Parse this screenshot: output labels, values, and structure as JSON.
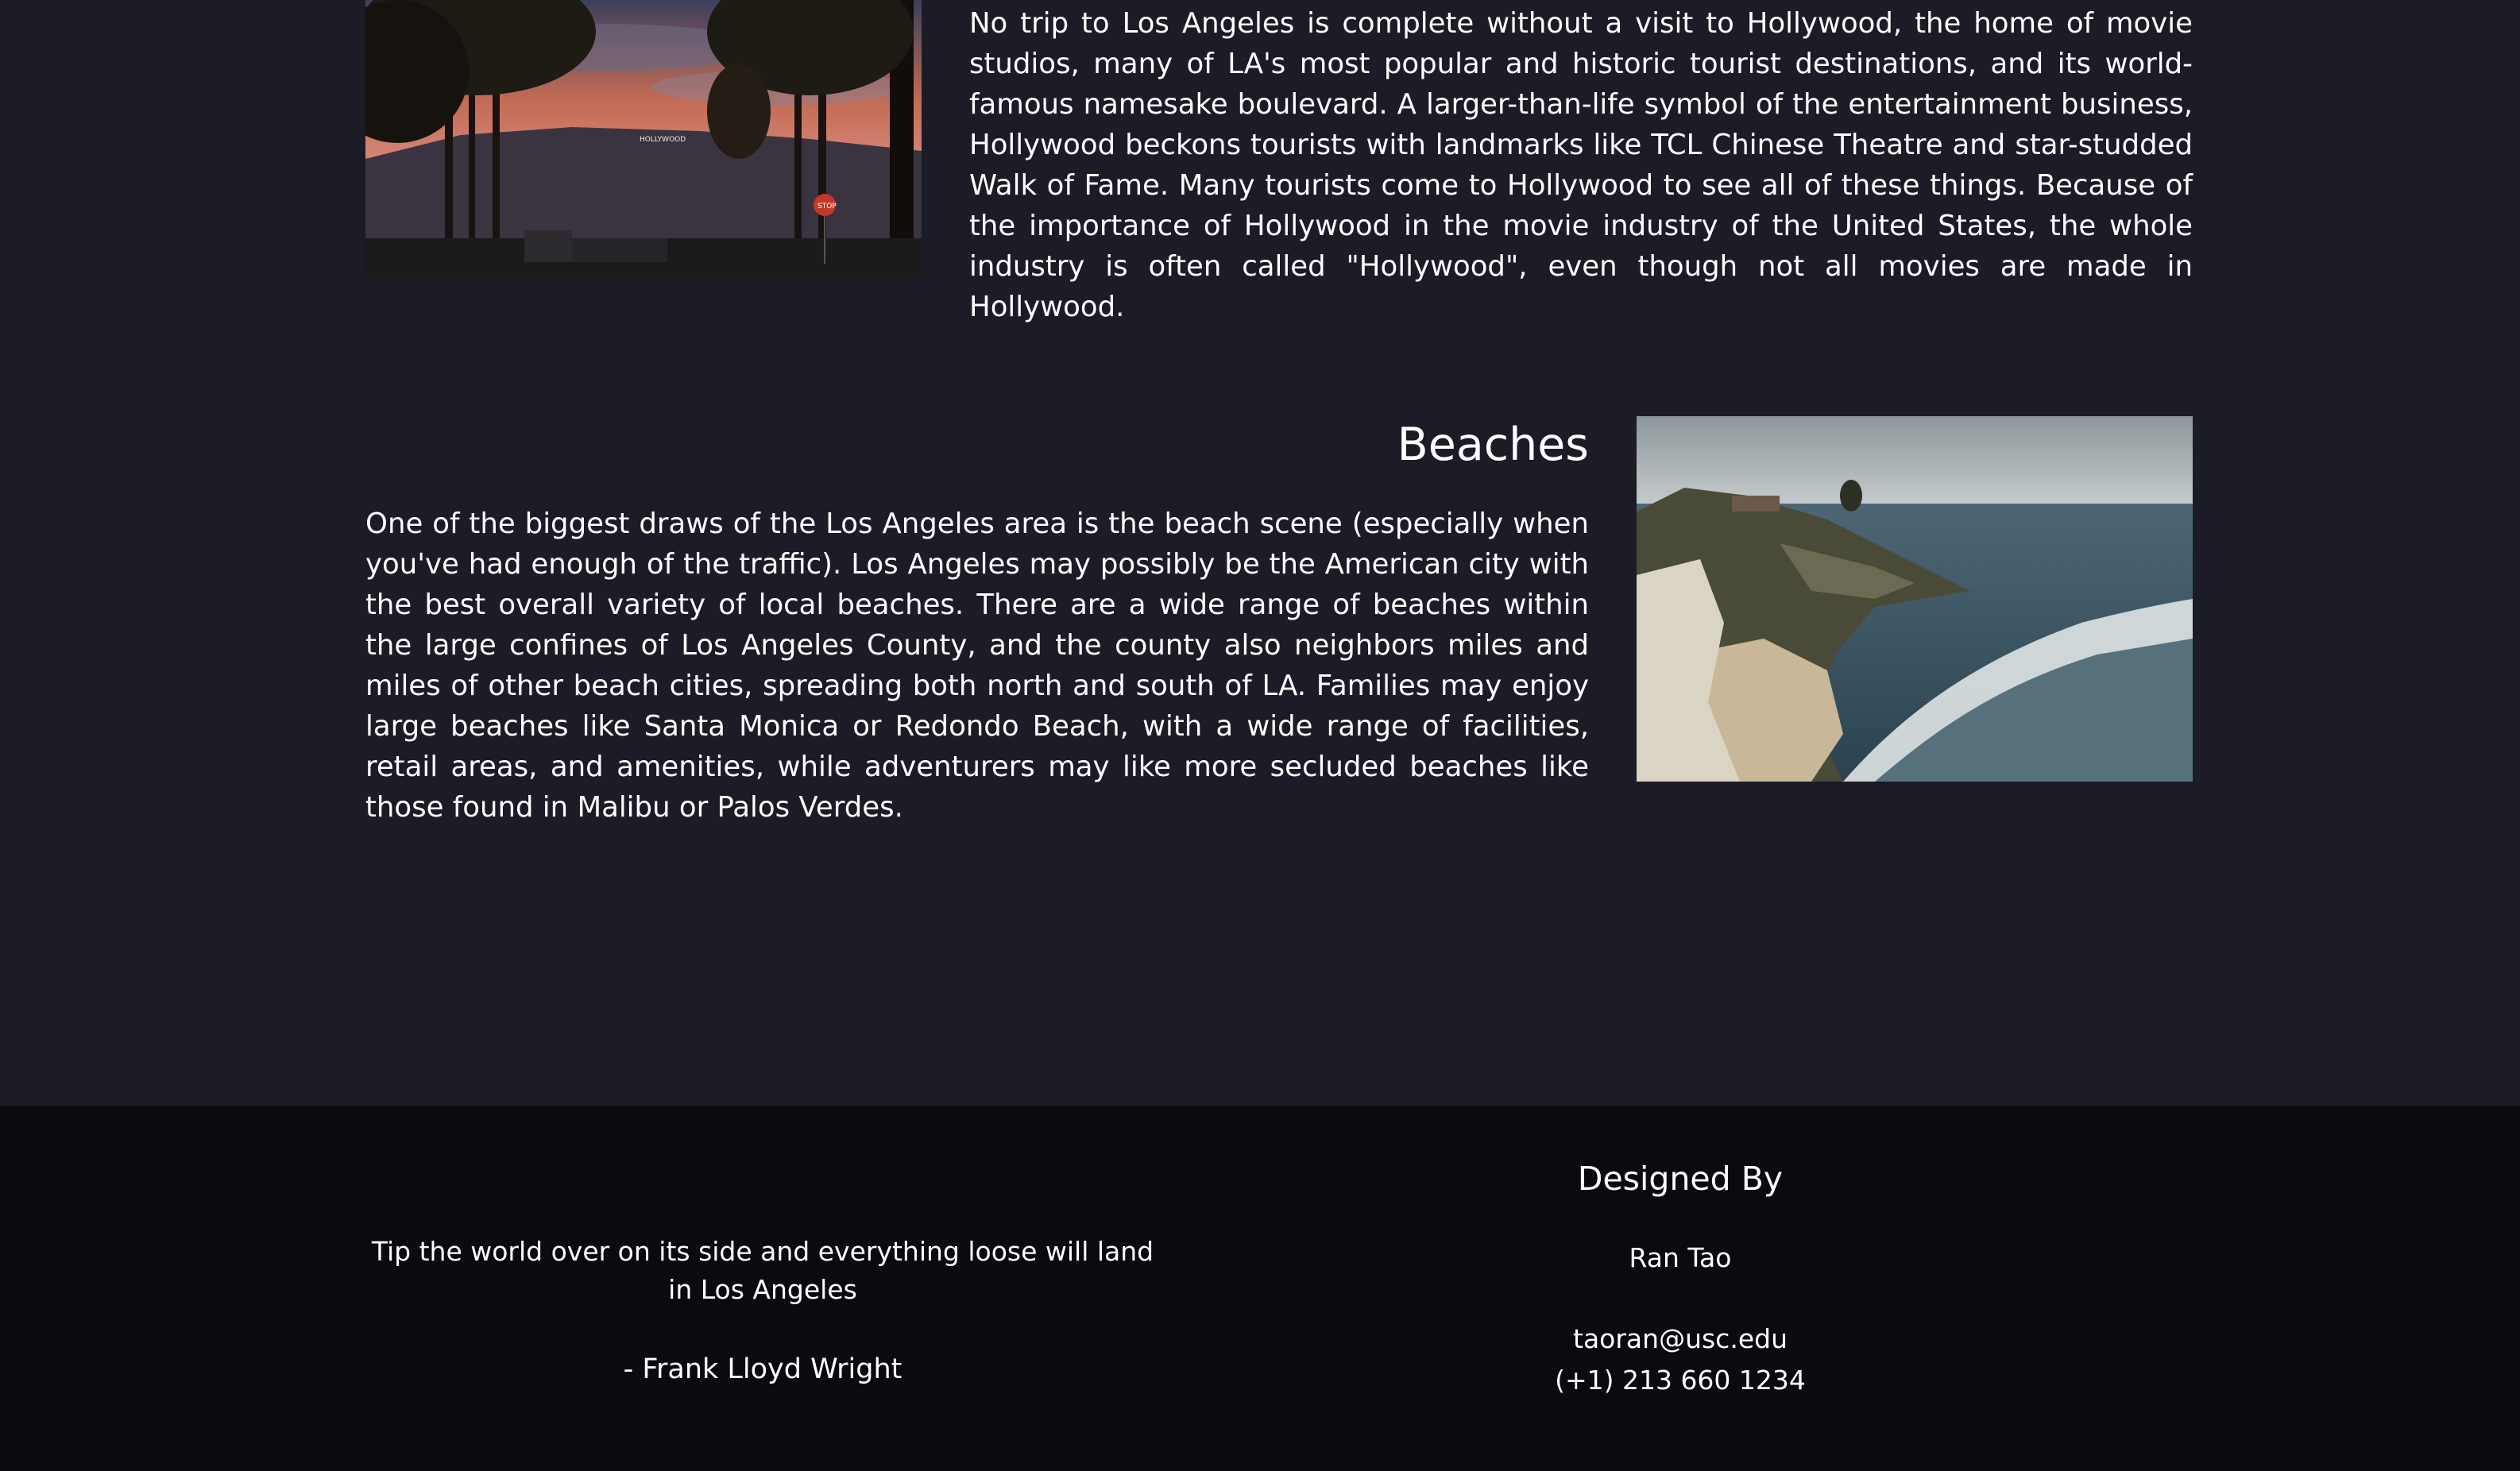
{
  "hollywood": {
    "paragraph": "No trip to Los Angeles is complete without a visit to Hollywood, the home of movie studios, many of LA's most popular and historic tourist destinations, and its world-famous namesake boulevard. A larger-than-life symbol of the entertainment business, Hollywood beckons tourists with landmarks like TCL Chinese Theatre and star-studded Walk of Fame. Many tourists come to Hollywood to see all of these things. Because of the importance of Hollywood in the movie industry of the United States, the whole industry is often called \"Hollywood\", even though not all movies are made in Hollywood.",
    "sign_text": "HOLLYWOOD",
    "stop_sign_text": "STOP"
  },
  "beaches": {
    "title": "Beaches",
    "paragraph": "One of the biggest draws of the Los Angeles area is the beach scene (especially when you've had enough of the traffic). Los Angeles may possibly be the American city with the best overall variety of local beaches. There are a wide range of beaches within the large confines of Los Angeles County, and the county also neighbors miles and miles of other beach cities, spreading both north and south of LA. Families may enjoy large beaches like Santa Monica or Redondo Beach, with a wide range of facilities, retail areas, and amenities, while adventurers may like more secluded beaches like those found in Malibu or Palos Verdes."
  },
  "footer": {
    "quote": "Tip the world over on its side and everything loose will land in Los Angeles",
    "quote_author": "- Frank Lloyd Wright",
    "designed_by_heading": "Designed By",
    "designer_name": "Ran Tao",
    "email": "taoran@usc.edu",
    "phone": "(+1) 213 660 1234"
  },
  "colors": {
    "page_background": "#1b1c25",
    "footer_background": "#090b11",
    "text": "#ffffff"
  }
}
